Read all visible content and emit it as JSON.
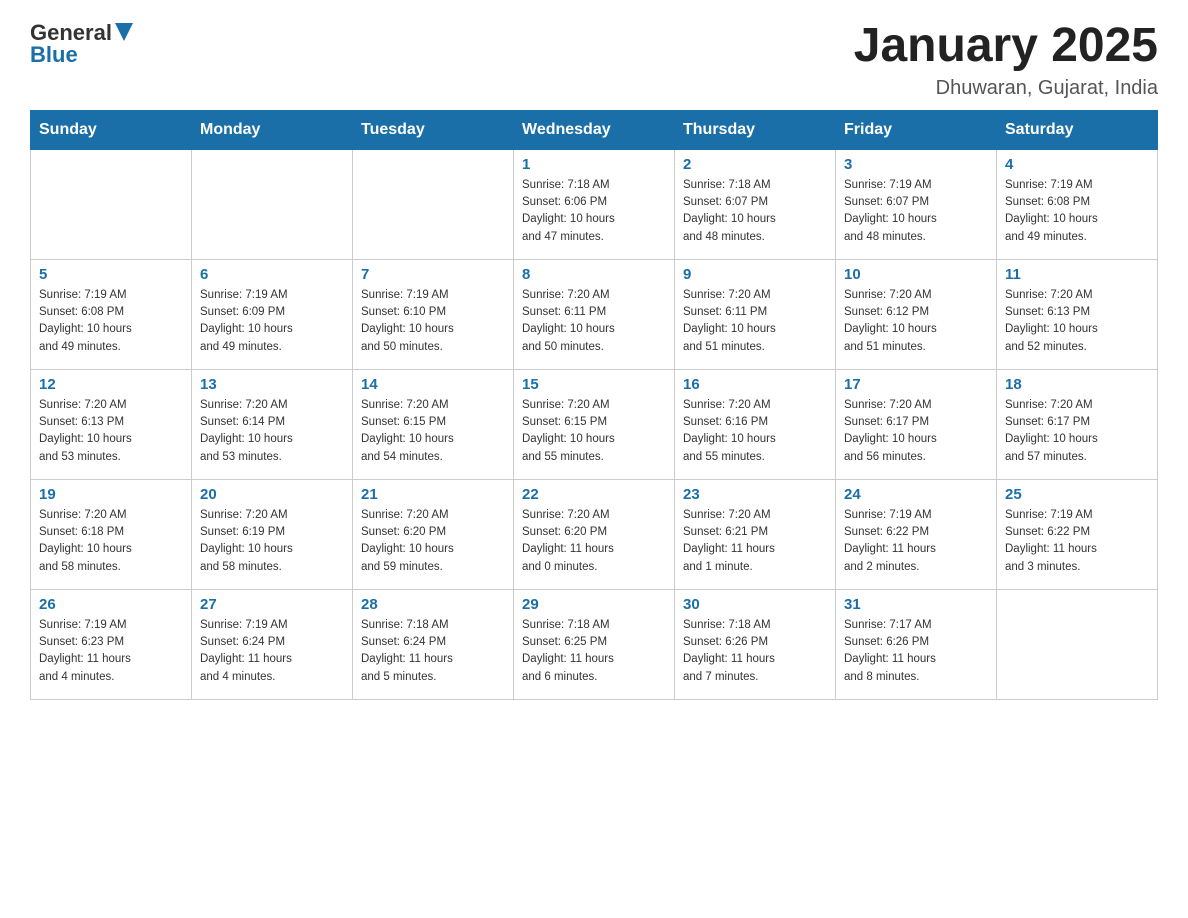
{
  "header": {
    "logo": {
      "text_general": "General",
      "text_blue": "Blue"
    },
    "title": "January 2025",
    "subtitle": "Dhuwaran, Gujarat, India"
  },
  "days_of_week": [
    "Sunday",
    "Monday",
    "Tuesday",
    "Wednesday",
    "Thursday",
    "Friday",
    "Saturday"
  ],
  "weeks": [
    [
      {
        "day": "",
        "info": ""
      },
      {
        "day": "",
        "info": ""
      },
      {
        "day": "",
        "info": ""
      },
      {
        "day": "1",
        "info": "Sunrise: 7:18 AM\nSunset: 6:06 PM\nDaylight: 10 hours\nand 47 minutes."
      },
      {
        "day": "2",
        "info": "Sunrise: 7:18 AM\nSunset: 6:07 PM\nDaylight: 10 hours\nand 48 minutes."
      },
      {
        "day": "3",
        "info": "Sunrise: 7:19 AM\nSunset: 6:07 PM\nDaylight: 10 hours\nand 48 minutes."
      },
      {
        "day": "4",
        "info": "Sunrise: 7:19 AM\nSunset: 6:08 PM\nDaylight: 10 hours\nand 49 minutes."
      }
    ],
    [
      {
        "day": "5",
        "info": "Sunrise: 7:19 AM\nSunset: 6:08 PM\nDaylight: 10 hours\nand 49 minutes."
      },
      {
        "day": "6",
        "info": "Sunrise: 7:19 AM\nSunset: 6:09 PM\nDaylight: 10 hours\nand 49 minutes."
      },
      {
        "day": "7",
        "info": "Sunrise: 7:19 AM\nSunset: 6:10 PM\nDaylight: 10 hours\nand 50 minutes."
      },
      {
        "day": "8",
        "info": "Sunrise: 7:20 AM\nSunset: 6:11 PM\nDaylight: 10 hours\nand 50 minutes."
      },
      {
        "day": "9",
        "info": "Sunrise: 7:20 AM\nSunset: 6:11 PM\nDaylight: 10 hours\nand 51 minutes."
      },
      {
        "day": "10",
        "info": "Sunrise: 7:20 AM\nSunset: 6:12 PM\nDaylight: 10 hours\nand 51 minutes."
      },
      {
        "day": "11",
        "info": "Sunrise: 7:20 AM\nSunset: 6:13 PM\nDaylight: 10 hours\nand 52 minutes."
      }
    ],
    [
      {
        "day": "12",
        "info": "Sunrise: 7:20 AM\nSunset: 6:13 PM\nDaylight: 10 hours\nand 53 minutes."
      },
      {
        "day": "13",
        "info": "Sunrise: 7:20 AM\nSunset: 6:14 PM\nDaylight: 10 hours\nand 53 minutes."
      },
      {
        "day": "14",
        "info": "Sunrise: 7:20 AM\nSunset: 6:15 PM\nDaylight: 10 hours\nand 54 minutes."
      },
      {
        "day": "15",
        "info": "Sunrise: 7:20 AM\nSunset: 6:15 PM\nDaylight: 10 hours\nand 55 minutes."
      },
      {
        "day": "16",
        "info": "Sunrise: 7:20 AM\nSunset: 6:16 PM\nDaylight: 10 hours\nand 55 minutes."
      },
      {
        "day": "17",
        "info": "Sunrise: 7:20 AM\nSunset: 6:17 PM\nDaylight: 10 hours\nand 56 minutes."
      },
      {
        "day": "18",
        "info": "Sunrise: 7:20 AM\nSunset: 6:17 PM\nDaylight: 10 hours\nand 57 minutes."
      }
    ],
    [
      {
        "day": "19",
        "info": "Sunrise: 7:20 AM\nSunset: 6:18 PM\nDaylight: 10 hours\nand 58 minutes."
      },
      {
        "day": "20",
        "info": "Sunrise: 7:20 AM\nSunset: 6:19 PM\nDaylight: 10 hours\nand 58 minutes."
      },
      {
        "day": "21",
        "info": "Sunrise: 7:20 AM\nSunset: 6:20 PM\nDaylight: 10 hours\nand 59 minutes."
      },
      {
        "day": "22",
        "info": "Sunrise: 7:20 AM\nSunset: 6:20 PM\nDaylight: 11 hours\nand 0 minutes."
      },
      {
        "day": "23",
        "info": "Sunrise: 7:20 AM\nSunset: 6:21 PM\nDaylight: 11 hours\nand 1 minute."
      },
      {
        "day": "24",
        "info": "Sunrise: 7:19 AM\nSunset: 6:22 PM\nDaylight: 11 hours\nand 2 minutes."
      },
      {
        "day": "25",
        "info": "Sunrise: 7:19 AM\nSunset: 6:22 PM\nDaylight: 11 hours\nand 3 minutes."
      }
    ],
    [
      {
        "day": "26",
        "info": "Sunrise: 7:19 AM\nSunset: 6:23 PM\nDaylight: 11 hours\nand 4 minutes."
      },
      {
        "day": "27",
        "info": "Sunrise: 7:19 AM\nSunset: 6:24 PM\nDaylight: 11 hours\nand 4 minutes."
      },
      {
        "day": "28",
        "info": "Sunrise: 7:18 AM\nSunset: 6:24 PM\nDaylight: 11 hours\nand 5 minutes."
      },
      {
        "day": "29",
        "info": "Sunrise: 7:18 AM\nSunset: 6:25 PM\nDaylight: 11 hours\nand 6 minutes."
      },
      {
        "day": "30",
        "info": "Sunrise: 7:18 AM\nSunset: 6:26 PM\nDaylight: 11 hours\nand 7 minutes."
      },
      {
        "day": "31",
        "info": "Sunrise: 7:17 AM\nSunset: 6:26 PM\nDaylight: 11 hours\nand 8 minutes."
      },
      {
        "day": "",
        "info": ""
      }
    ]
  ]
}
